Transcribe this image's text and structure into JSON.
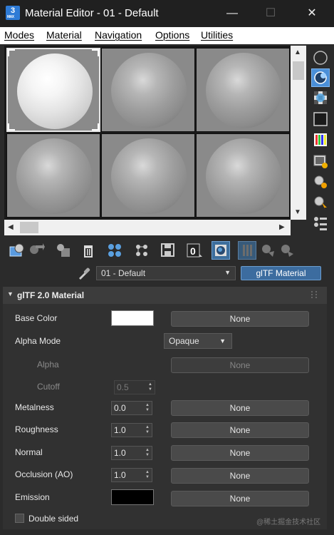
{
  "window": {
    "app_icon_label": "3",
    "app_icon_sub": "MAX",
    "title": "Material Editor - 01 - Default",
    "minimize": "—",
    "maximize": "☐",
    "close": "✕"
  },
  "menu": {
    "items": [
      "Modes",
      "Material",
      "Navigation",
      "Options",
      "Utilities"
    ]
  },
  "scroll": {
    "up": "▲",
    "down": "▼",
    "left": "◀",
    "right": "▶"
  },
  "material_row": {
    "selected_material": "01 - Default",
    "dropdown_arrow": "▼",
    "type_button": "glTF Material"
  },
  "rollout": {
    "caret": "▼",
    "title": "glTF 2.0 Material"
  },
  "properties": {
    "base_color": {
      "label": "Base Color",
      "swatch": "#ffffff",
      "map": "None"
    },
    "alpha_mode": {
      "label": "Alpha Mode",
      "value": "Opaque",
      "arrow": "▼"
    },
    "alpha": {
      "label": "Alpha",
      "map": "None"
    },
    "cutoff": {
      "label": "Cutoff",
      "value": "0.5"
    },
    "metalness": {
      "label": "Metalness",
      "value": "0.0",
      "map": "None"
    },
    "roughness": {
      "label": "Roughness",
      "value": "1.0",
      "map": "None"
    },
    "normal": {
      "label": "Normal",
      "value": "1.0",
      "map": "None"
    },
    "occlusion": {
      "label": "Occlusion (AO)",
      "value": "1.0",
      "map": "None"
    },
    "emission": {
      "label": "Emission",
      "swatch": "#000000",
      "map": "None"
    },
    "double_sided": {
      "label": "Double sided",
      "checked": false
    }
  },
  "spinner_arrows": "▲\n▼",
  "watermark": "@稀土掘金技术社区",
  "colors": {
    "title_bar": "#202020",
    "panel": "#2b2b2b",
    "accent": "#4a8fd8",
    "type_button": "#3c6c9f"
  },
  "icons": {
    "side_toolbar": [
      "sample-type-sphere-icon",
      "backlight-icon",
      "background-checker-icon",
      "sample-uv-tiling-icon",
      "video-color-check-icon",
      "make-preview-icon",
      "options-icon",
      "select-by-material-icon",
      "material-map-navigator-icon"
    ],
    "bottom_toolbar": [
      "get-material-icon",
      "put-to-scene-icon",
      "assign-to-selection-icon",
      "reset-map-icon",
      "make-unique-icon",
      "put-to-library-icon",
      "material-id-channel-icon",
      "show-shaded-in-viewport-icon",
      "show-end-result-icon",
      "go-to-parent-icon",
      "go-forward-to-sibling-icon"
    ]
  }
}
